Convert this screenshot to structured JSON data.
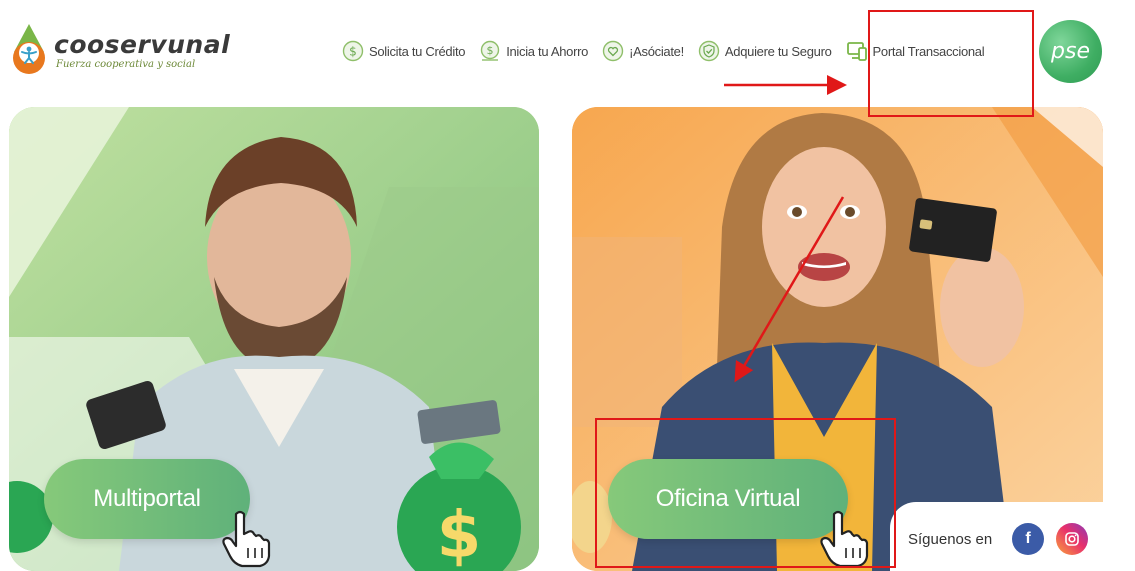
{
  "brand": {
    "name": "cooservunal",
    "tagline": "Fuerza cooperativa y social"
  },
  "nav": {
    "items": [
      {
        "label": "Solicita tu Crédito",
        "icon": "dollar-circle-icon"
      },
      {
        "label": "Inicia tu Ahorro",
        "icon": "savings-coin-icon"
      },
      {
        "label": "¡Asóciate!",
        "icon": "heart-circle-icon"
      },
      {
        "label": "Adquiere tu Seguro",
        "icon": "shield-check-icon"
      },
      {
        "label": "Portal Transaccional",
        "icon": "devices-icon"
      }
    ],
    "pse_label": "pse"
  },
  "cards": {
    "left": {
      "button": "Multiportal"
    },
    "right": {
      "button": "Oficina Virtual"
    }
  },
  "social": {
    "label": "Síguenos en",
    "facebook": "f",
    "instagram_icon": "instagram-icon"
  },
  "colors": {
    "brand_green": "#6aa84f",
    "brand_orange": "#e8781e",
    "pill_green": "#6dbb78",
    "annotation_red": "#e01818",
    "facebook_blue": "#3b5ba7"
  }
}
